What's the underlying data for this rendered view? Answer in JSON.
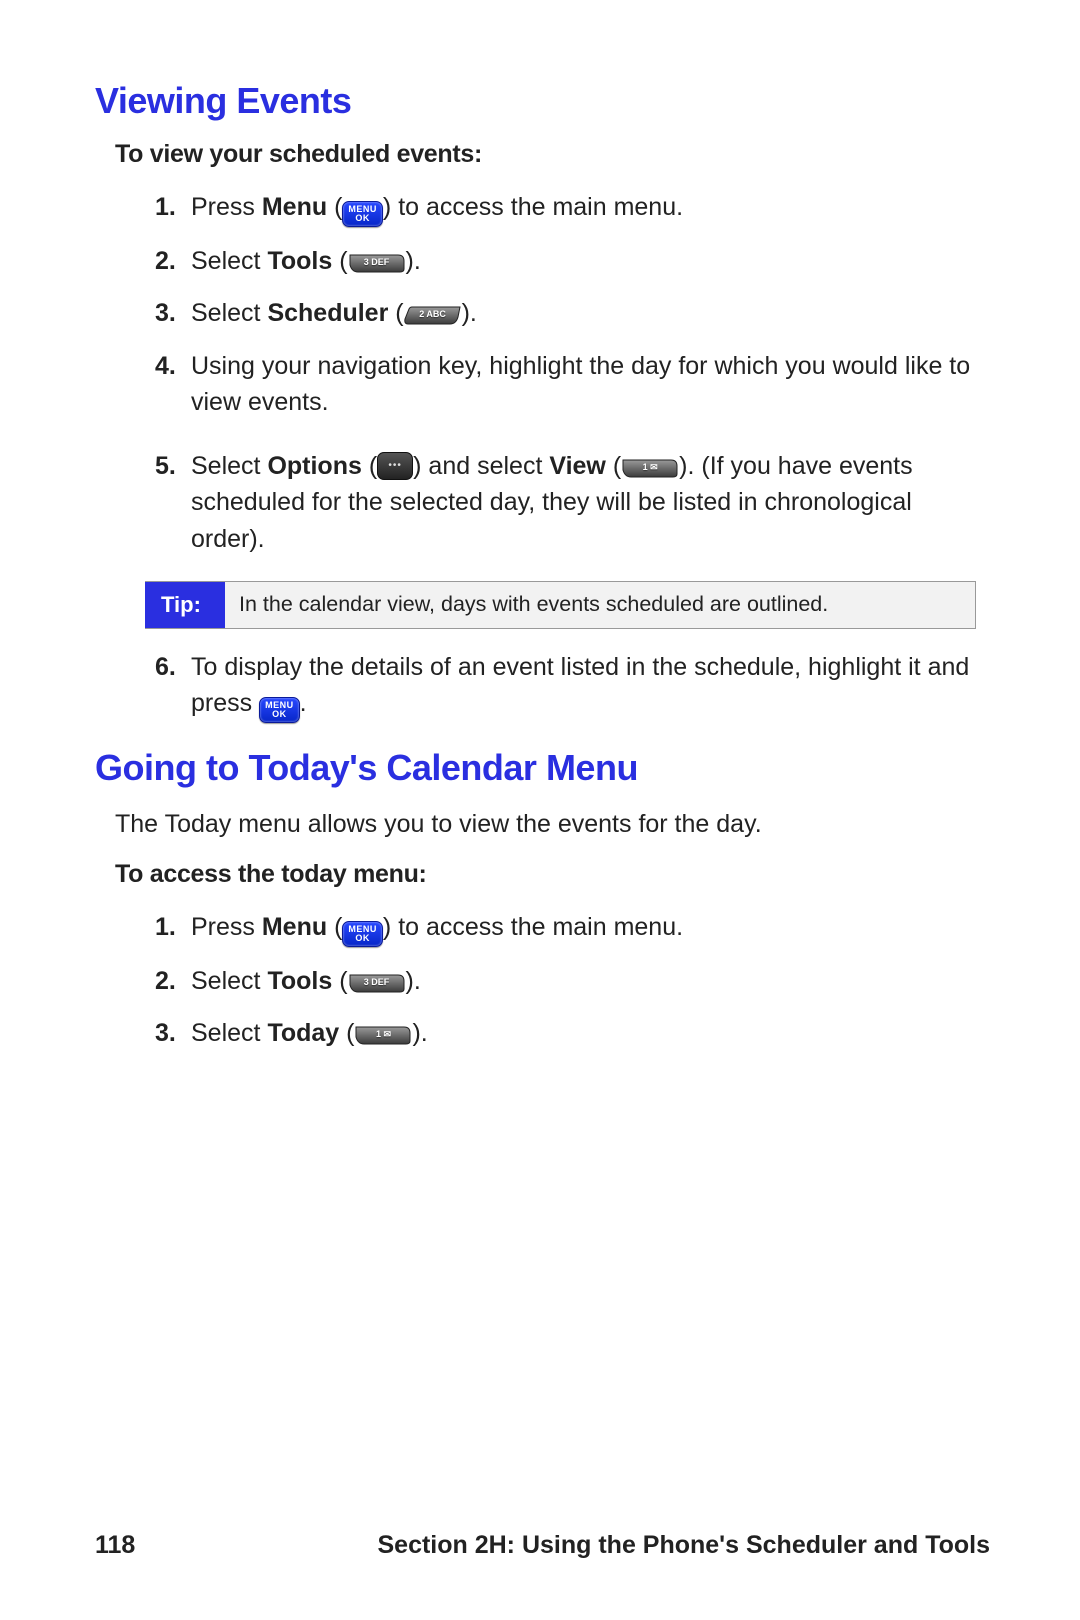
{
  "section1": {
    "title": "Viewing Events",
    "subhead": "To view your scheduled events:",
    "steps": [
      {
        "pre": "Press ",
        "bold": "Menu",
        "post1": " (",
        "icon": "menu-ok",
        "post2": ") to access the main menu."
      },
      {
        "pre": "Select ",
        "bold": "Tools",
        "post1": " (",
        "icon": "key-3def",
        "post2": ")."
      },
      {
        "pre": "Select ",
        "bold": "Scheduler",
        "post1": " (",
        "icon": "key-2abc",
        "post2": ")."
      },
      {
        "text": "Using your navigation key, highlight the day for which you would like to view events."
      },
      {
        "pre": "Select ",
        "bold": "Options",
        "post1": " (",
        "icon": "soft-dots",
        "mid1": ") and select ",
        "bold2": "View",
        "post2": " (",
        "icon2": "key-1",
        "post3": "). (If you have events scheduled for the selected day, they will be listed in chronological order)."
      }
    ],
    "tip_label": "Tip:",
    "tip_text": "In the calendar view, days with events scheduled are outlined.",
    "steps2": [
      {
        "pre": "To display the details of an event listed in the schedule, highlight it and press ",
        "icon": "menu-ok",
        "post": "."
      }
    ]
  },
  "section2": {
    "title": "Going to Today's Calendar Menu",
    "intro": "The Today menu allows you to view the events for the day.",
    "subhead": "To access the today menu:",
    "steps": [
      {
        "pre": "Press ",
        "bold": "Menu",
        "post1": " (",
        "icon": "menu-ok",
        "post2": ") to access the main menu."
      },
      {
        "pre": "Select ",
        "bold": "Tools",
        "post1": " (",
        "icon": "key-3def",
        "post2": ")."
      },
      {
        "pre": "Select ",
        "bold": "Today",
        "post1": " (",
        "icon": "key-1",
        "post2": ")."
      }
    ]
  },
  "footer": {
    "page": "118",
    "section": "Section 2H: Using the Phone's Scheduler and Tools"
  },
  "icons": {
    "menu_l1": "MENU",
    "menu_l2": "OK",
    "k3": "3 DEF",
    "k2": "2 ABC",
    "k1": "1 ✉"
  }
}
